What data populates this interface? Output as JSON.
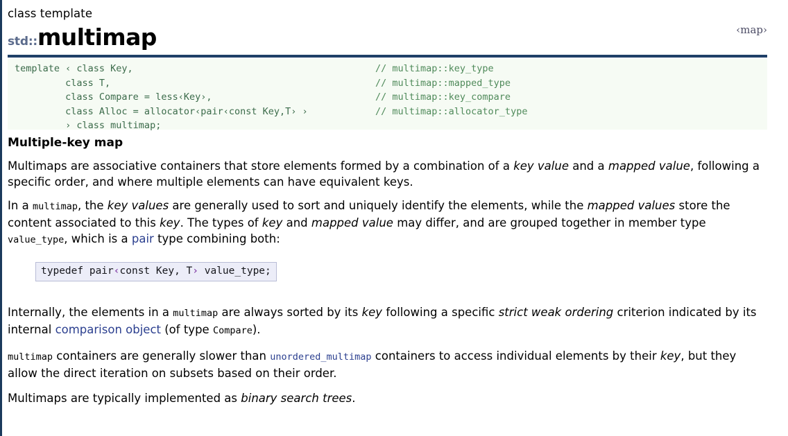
{
  "header": {
    "kind": "class template",
    "namespace": "std::",
    "name": "multimap",
    "header_link": "‹map›"
  },
  "prototype": {
    "left_lines": [
      "template ‹ class Key,",
      "         class T,",
      "         class Compare = less‹Key›,",
      "         class Alloc = allocator‹pair‹const Key,T› ›",
      "         › class multimap;"
    ],
    "comments": [
      "// multimap::key_type",
      "// multimap::mapped_type",
      "// multimap::key_compare",
      "// multimap::allocator_type"
    ]
  },
  "section": {
    "title": "Multiple-key map"
  },
  "paragraphs": {
    "p1_a": "Multimaps are associative containers that store elements formed by a combination of a ",
    "p1_key_value": "key value",
    "p1_b": " and a ",
    "p1_mapped_value": "mapped value",
    "p1_c": ", following a specific order, and where multiple elements can have equivalent keys.",
    "p2_a": "In a ",
    "p2_multimap": "multimap",
    "p2_b": ", the ",
    "p2_key_values": "key values",
    "p2_c": " are generally used to sort and uniquely identify the elements, while the ",
    "p2_mapped_values": "mapped values",
    "p2_d": " store the content associated to this ",
    "p2_key1": "key",
    "p2_e": ". The types of ",
    "p2_key2": "key",
    "p2_f": " and ",
    "p2_mapped_value": "mapped value",
    "p2_g": " may differ, and are grouped together in member type ",
    "p2_value_type": "value_type",
    "p2_h": ", which is a ",
    "p2_pair_link": "pair",
    "p2_i": " type combining both:",
    "p3_a": "Internally, the elements in a ",
    "p3_multimap": "multimap",
    "p3_b": " are always sorted by its ",
    "p3_key": "key",
    "p3_c": " following a specific ",
    "p3_swo": "strict weak ordering",
    "p3_d": " criterion indicated by its internal ",
    "p3_cmp_link": "comparison object",
    "p3_e": " (of type ",
    "p3_compare": "Compare",
    "p3_f": ").",
    "p4_multimap": "multimap",
    "p4_a": " containers are generally slower than ",
    "p4_unordered_link": "unordered_multimap",
    "p4_b": " containers to access individual elements by their ",
    "p4_key": "key",
    "p4_c": ", but they allow the direct iteration on subsets based on their order.",
    "p5_a": "Multimaps are typically implemented as ",
    "p5_bst": "binary search trees",
    "p5_b": "."
  },
  "typedef_box": {
    "kw": "typedef ",
    "pair": "pair",
    "lt": "‹",
    "inner": "const Key, T",
    "gt": "›",
    "tail": " value_type;"
  },
  "colors": {
    "rule": "#1f4068",
    "namespace": "#5b6b8c",
    "link": "#2b3f8f",
    "proto_bg": "#f6fbf4",
    "proto_comment": "#4f8a5a",
    "typedef_bg": "#ecedf8"
  }
}
